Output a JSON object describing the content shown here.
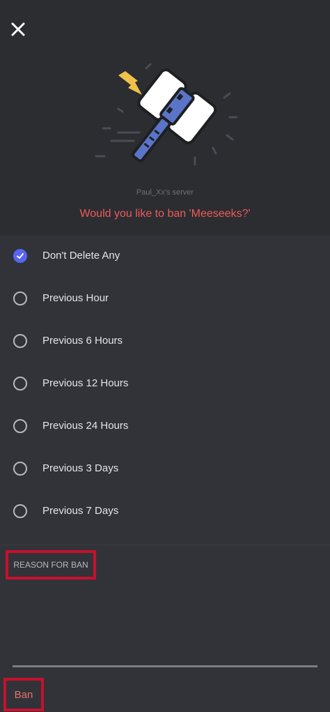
{
  "dialog": {
    "server_name": "Paul_Xx's server",
    "question": "Would you like to ban 'Meeseeks?'"
  },
  "delete_message_options": [
    {
      "label": "Don't Delete Any",
      "selected": true
    },
    {
      "label": "Previous Hour",
      "selected": false
    },
    {
      "label": "Previous 6 Hours",
      "selected": false
    },
    {
      "label": "Previous 12 Hours",
      "selected": false
    },
    {
      "label": "Previous 24 Hours",
      "selected": false
    },
    {
      "label": "Previous 3 Days",
      "selected": false
    },
    {
      "label": "Previous 7 Days",
      "selected": false
    }
  ],
  "reason": {
    "label": "REASON FOR BAN",
    "value": ""
  },
  "actions": {
    "ban_label": "Ban"
  },
  "icons": {
    "close": "close-icon",
    "radio_checked": "check-icon",
    "hero": "ban-hammer-illustration"
  },
  "colors": {
    "background": "#2b2d31",
    "panel": "#313338",
    "accent": "#5865f2",
    "danger_text": "#f05a5a",
    "highlight_border": "#c8102e"
  }
}
